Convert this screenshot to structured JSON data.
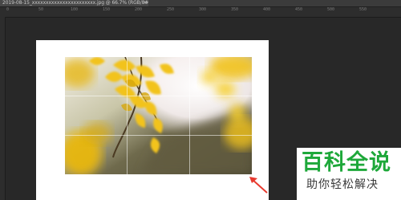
{
  "document_tab": {
    "title": "2019-08-15_xxxxxxxxxxxxxxxxxxxxxxx.jpg @ 66.7% (RGB/8#) *",
    "close_glyph": "×"
  },
  "ruler": {
    "ticks": [
      "0",
      "50",
      "100",
      "150",
      "200",
      "250",
      "300",
      "350",
      "400",
      "450",
      "500",
      "550"
    ]
  },
  "canvas": {
    "background": "#ffffff",
    "photo_subject": "yellow ginkgo leaves on branch, backlit",
    "guide_grid": "rule-of-thirds"
  },
  "annotation": {
    "arrow_color": "#e83a2f",
    "arrow_icon": "red-arrow-icon"
  },
  "watermark": {
    "title": "百科全说",
    "subtitle": "助你轻松解决",
    "title_color": "#1ea83a"
  }
}
